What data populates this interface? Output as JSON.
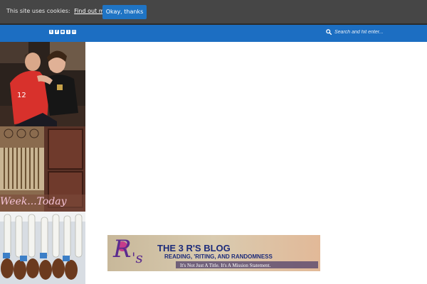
{
  "cookie_bar": {
    "message": "This site uses cookies:",
    "link_text": "Find out more.",
    "accept_label": "Okay, thanks"
  },
  "nav": {
    "social_icons": [
      "twitter-icon",
      "facebook-icon",
      "instagram-icon",
      "rss-icon",
      "email-icon"
    ],
    "search_placeholder": "Search and hit enter..."
  },
  "sidebar": {
    "thumbnails": [
      {
        "name": "two-boys-photo"
      },
      {
        "name": "church-doors-photo",
        "caption": "Week...Today"
      },
      {
        "name": "bowling-pins-photo"
      }
    ]
  },
  "banner": {
    "title": "THE 3 R'S BLOG",
    "subtitle": "READING, 'RITING, AND RANDOMNESS",
    "motto": "It's Not Just A Title. It's A Mission Statement."
  },
  "colors": {
    "cookie_bar": "#464646",
    "accent": "#1f74c4",
    "nav_bar": "#1c6ec2",
    "banner_text": "#1c2b7a"
  }
}
